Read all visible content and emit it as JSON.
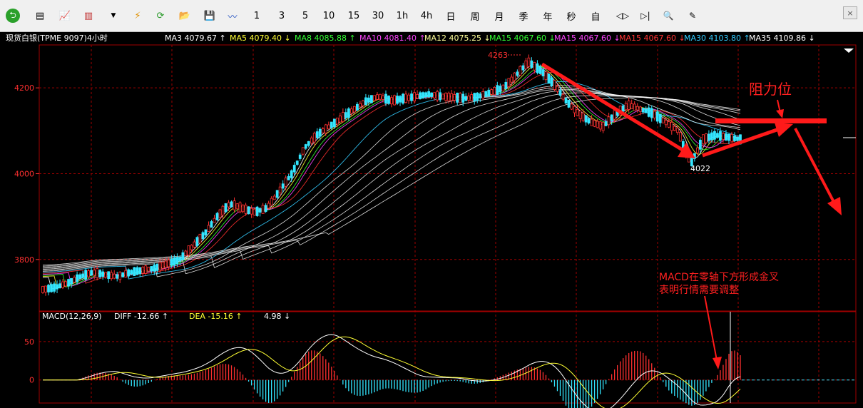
{
  "toolbar": {
    "icons": [
      "back-icon",
      "list-icon",
      "line-chart-icon",
      "candlestick-icon",
      "dropdown-arrow-icon",
      "lightning-icon",
      "refresh-icon",
      "open-folder-icon",
      "save-icon",
      "wave-icon"
    ],
    "periods": [
      "1",
      "3",
      "5",
      "10",
      "15",
      "30",
      "1h",
      "4h",
      "日",
      "周",
      "月",
      "季",
      "年",
      "秒",
      "自"
    ],
    "right_icons": [
      "zoom-in-out-icon",
      "zoom-step-icon",
      "search-icon",
      "draw-pen-icon"
    ],
    "close": "×"
  },
  "header": {
    "symbol": "现货白银(TPME 9097)4小时",
    "ma": [
      {
        "label": "MA3 4079.67 ↑",
        "color": "#ffffff"
      },
      {
        "label": "MA5 4079.40 ↓",
        "color": "#ffff33"
      },
      {
        "label": "MA8 4085.88 ↑",
        "color": "#33ff33"
      },
      {
        "label": "MA10 4081.40 ↑",
        "color": "#ff44ff"
      },
      {
        "label": "MA12 4075.25 ↓",
        "color": "#ffff99"
      },
      {
        "label": "MA15 4067.60 ↓",
        "color": "#33ff33"
      },
      {
        "label": "MA15 4067.60 ↓",
        "color": "#ff44ff"
      },
      {
        "label": "MA15 4067.60 ↓",
        "color": "#ff3333"
      },
      {
        "label": "MA30 4103.80 ↑",
        "color": "#33ccff"
      },
      {
        "label": "MA35 4109.86 ↓",
        "color": "#ffffff"
      }
    ]
  },
  "price_axis": {
    "labels": [
      "4200",
      "4000",
      "3800"
    ],
    "values": [
      4200,
      4000,
      3800
    ]
  },
  "macd_header": {
    "label": "MACD(12,26,9)",
    "diff": "DIFF  -12.66 ↑",
    "dea": "DEA  -15.16 ↑",
    "hist": "4.98 ↓"
  },
  "macd_axis": {
    "labels": [
      "50",
      "0"
    ],
    "values": [
      50,
      0
    ]
  },
  "annotations": {
    "high": "4263",
    "low": "4022",
    "resistance": "阻力位",
    "macd_note_1": "MACD在零轴下方形成金叉",
    "macd_note_2": "表明行情需要调整"
  },
  "colors": {
    "up": "#ff3030",
    "down": "#33e6ff",
    "grid": "#a00000",
    "arrow": "#ff1a1a"
  },
  "chart_data": {
    "type": "candlestick",
    "price_ylim": [
      3680,
      4300
    ],
    "macd_ylim": [
      -30,
      75
    ],
    "price_points": [
      3730,
      3735,
      3745,
      3760,
      3770,
      3765,
      3760,
      3770,
      3775,
      3780,
      3790,
      3800,
      3830,
      3860,
      3900,
      3930,
      3920,
      3910,
      3920,
      3960,
      4000,
      4060,
      4090,
      4110,
      4130,
      4150,
      4170,
      4180,
      4170,
      4175,
      4180,
      4185,
      4180,
      4178,
      4175,
      4180,
      4190,
      4200,
      4230,
      4260,
      4240,
      4210,
      4170,
      4140,
      4120,
      4110,
      4140,
      4160,
      4150,
      4140,
      4120,
      4100,
      4022,
      4080,
      4090,
      4085,
      4080
    ],
    "low": 4022,
    "high": 4263
  }
}
